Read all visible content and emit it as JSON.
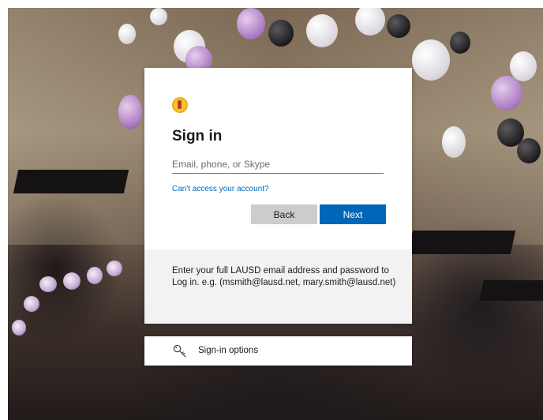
{
  "signin": {
    "title": "Sign in",
    "email_placeholder": "Email, phone, or Skype",
    "email_value": "",
    "cant_access_link": "Can't access your account?",
    "back_label": "Back",
    "next_label": "Next",
    "info_text": "Enter your full LAUSD email address and password to Log in. e.g. (msmith@lausd.net, mary.smith@lausd.net)"
  },
  "signin_options": {
    "label": "Sign-in options",
    "icon": "key-icon"
  },
  "colors": {
    "primary": "#0067b8",
    "secondary_button": "#cccccc",
    "info_background": "#f2f2f2"
  }
}
